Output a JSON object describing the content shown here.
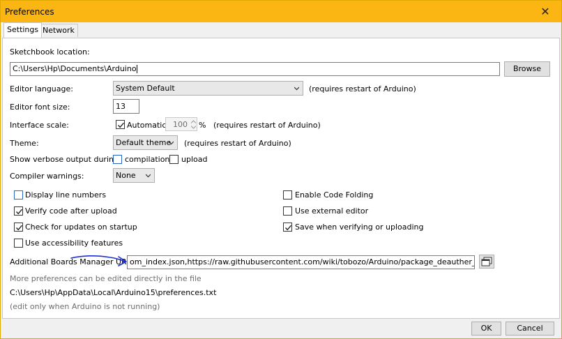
{
  "window": {
    "title": "Preferences",
    "close_glyph": "✕"
  },
  "tabs": [
    {
      "label": "Settings",
      "active": true
    },
    {
      "label": "Network",
      "active": false
    }
  ],
  "sketchbook": {
    "label": "Sketchbook location:",
    "value": "C:\\Users\\Hp\\Documents\\Arduino",
    "browse": "Browse"
  },
  "editor_language": {
    "label": "Editor language:",
    "value": "System Default",
    "note": "(requires restart of Arduino)"
  },
  "font_size": {
    "label": "Editor font size:",
    "value": "13"
  },
  "interface_scale": {
    "label": "Interface scale:",
    "automatic_label": "Automatic",
    "automatic_checked": true,
    "value": "100",
    "unit": "%",
    "note": "(requires restart of Arduino)"
  },
  "theme": {
    "label": "Theme:",
    "value": "Default theme",
    "note": "(requires restart of Arduino)"
  },
  "verbose": {
    "label": "Show verbose output during:",
    "compilation_label": "compilation",
    "compilation_checked": false,
    "upload_label": "upload",
    "upload_checked": false
  },
  "compiler_warnings": {
    "label": "Compiler warnings:",
    "value": "None"
  },
  "options_left": [
    {
      "label": "Display line numbers",
      "checked": false
    },
    {
      "label": "Verify code after upload",
      "checked": true
    },
    {
      "label": "Check for updates on startup",
      "checked": true
    },
    {
      "label": "Use accessibility features",
      "checked": false
    }
  ],
  "options_right": [
    {
      "label": "Enable Code Folding",
      "checked": false
    },
    {
      "label": "Use external editor",
      "checked": false
    },
    {
      "label": "Save when verifying or uploading",
      "checked": true
    }
  ],
  "boards_urls": {
    "label": "Additional Boards Manager URLs:",
    "value": "om_index.json,https://raw.githubusercontent.com/wiki/tobozo/Arduino/package_deauther_index.json"
  },
  "more_prefs": {
    "text": "More preferences can be edited directly in the file"
  },
  "prefs_path": "C:\\Users\\Hp\\AppData\\Local\\Arduino15\\preferences.txt",
  "edit_note": "(edit only when Arduino is not running)",
  "footer": {
    "ok": "OK",
    "cancel": "Cancel"
  },
  "colors": {
    "titlebar": "#fbb614",
    "annotation_arrow": "#1f2fd6"
  }
}
